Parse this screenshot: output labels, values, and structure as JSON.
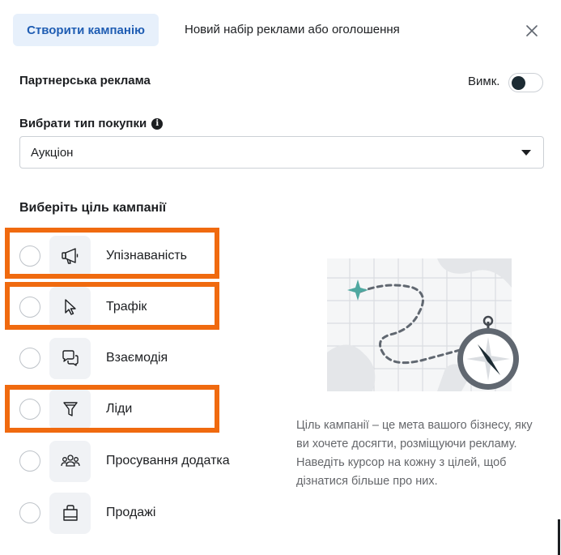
{
  "header": {
    "active_tab": "Створити кампанію",
    "tab2": "Новий набір реклами або оголошення",
    "close_icon": "close-icon"
  },
  "partner_ads": {
    "title": "Партнерська реклама",
    "toggle_label": "Вимк.",
    "toggle_on": false
  },
  "buy_type": {
    "label": "Вибрати тип покупки",
    "info_icon": "info-icon",
    "selected": "Аукціон"
  },
  "objectives": {
    "title": "Виберіть ціль кампанії",
    "items": [
      {
        "label": "Упізнаваність",
        "icon": "megaphone-icon",
        "highlighted": true
      },
      {
        "label": "Трафік",
        "icon": "cursor-icon",
        "highlighted": true
      },
      {
        "label": "Взаємодія",
        "icon": "chat-bubbles-icon",
        "highlighted": false
      },
      {
        "label": "Ліди",
        "icon": "funnel-icon",
        "highlighted": true
      },
      {
        "label": "Просування додатка",
        "icon": "people-group-icon",
        "highlighted": false
      },
      {
        "label": "Продажі",
        "icon": "shopping-bag-icon",
        "highlighted": false
      }
    ],
    "highlight_color": "#f06a0f"
  },
  "illustration": {
    "icon": "map-compass-illustration"
  },
  "description": "Ціль кампанії – це мета вашого бізнесу, яку ви хочете досягти, розміщуючи рекламу. Наведіть курсор на кожну з цілей, щоб дізнатися більше про них.",
  "colors": {
    "accent": "#1f5db3",
    "accent_bg": "#e7f0fb",
    "highlight": "#f06a0f"
  }
}
